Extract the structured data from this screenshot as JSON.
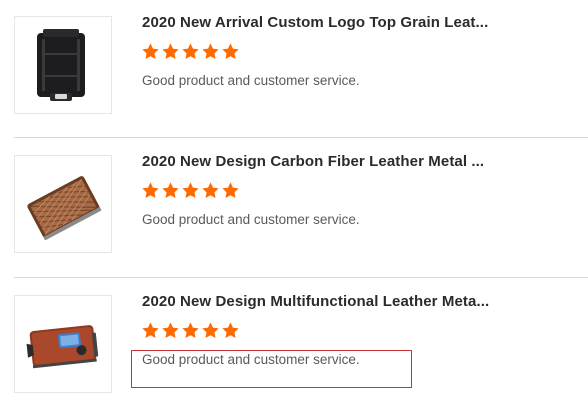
{
  "reviews": [
    {
      "title": "2020 New Arrival Custom Logo Top Grain Leat...",
      "rating_stars": 5,
      "comment": "Good product and customer service.",
      "image_icon": "black-metal-card-holder-image"
    },
    {
      "title": "2020 New Design Carbon Fiber Leather Metal ...",
      "rating_stars": 5,
      "comment": "Good product and customer service.",
      "image_icon": "carbon-fiber-brown-wallet-image"
    },
    {
      "title": "2020 New Design Multifunctional Leather Meta...",
      "rating_stars": 5,
      "comment": "Good product and customer service.",
      "image_icon": "brown-leather-wallet-image"
    }
  ],
  "colors": {
    "star": "#ff6a00",
    "highlight": "#c8333a",
    "separator": "#d9d9d9"
  }
}
